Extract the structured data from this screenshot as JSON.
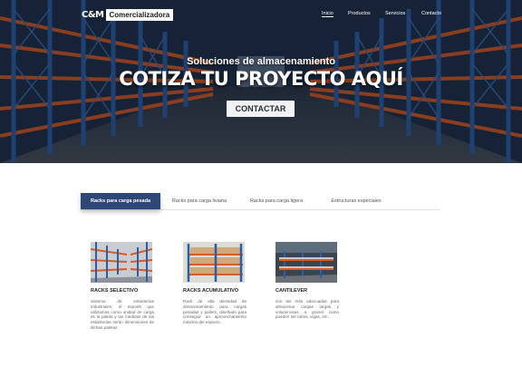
{
  "nav": {
    "logo_mark": "C&M",
    "logo_text": "Comercializadora",
    "links": [
      "Inicio",
      "Productos",
      "Servicios",
      "Contacto"
    ]
  },
  "hero": {
    "subtitle": "Soluciones de almacenamiento",
    "title": "COTIZA TU PROYECTO AQUÍ",
    "button": "CONTACTAR"
  },
  "tabs": [
    "Racks para carga pesada",
    "Racks para carga liviana",
    "Racks para carga ligera",
    "Estructuras especiales"
  ],
  "cards": [
    {
      "title": "RACKS SELECTIVO",
      "text": "Sistema de estanterías industriales, el soporte que utilizamos como unidad de carga es la paleta y las medidas de las estanterías serán dimensiones de dichas paletas"
    },
    {
      "title": "RACKS ACUMULATIVO",
      "text": "Rack de alta densidad de almacenamiento para cargas pesadas y palletz, diseñado para conseguir un aprovechamiento máximo del espacio."
    },
    {
      "title": "CANTILEVER",
      "text": "son las más adecuadas para almacenar cargas largas y voluminosas a granel como pueden ser tubos, vigas, etc."
    }
  ],
  "colors": {
    "tab_active": "#2d4777",
    "rack_orange": "#d95a23",
    "rack_blue": "#2a5fa8"
  }
}
